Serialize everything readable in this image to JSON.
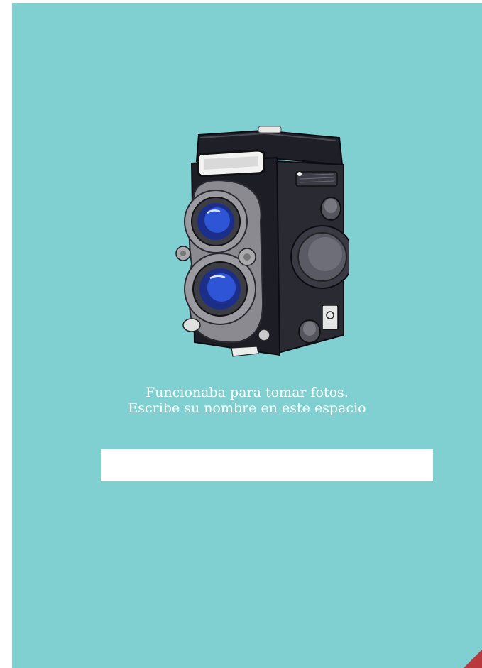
{
  "page": {
    "background_color": "#80cfd1",
    "corner_color": "#b8383d"
  },
  "illustration": {
    "icon": "twin-lens-reflex-camera-icon"
  },
  "prompt": {
    "line1": "Funcionaba para tomar fotos.",
    "line2": "Escribe su nombre en este espacio"
  },
  "answer": {
    "value": "",
    "placeholder": ""
  }
}
